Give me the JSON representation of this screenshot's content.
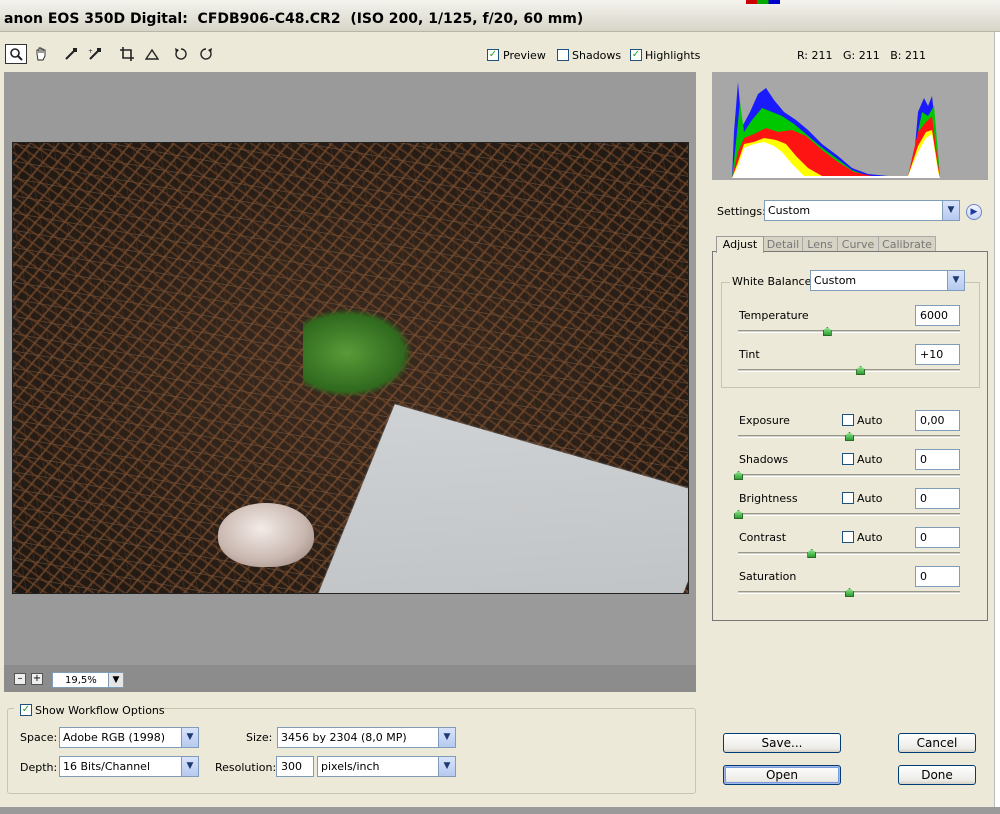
{
  "window": {
    "title": "anon EOS 350D Digital:  CFDB906-C48.CR2  (ISO 200, 1/125, f/20, 60 mm)"
  },
  "toolbar": {
    "tools": [
      "zoom-icon",
      "hand-icon",
      "white-balance-icon",
      "color-sampler-icon",
      "crop-icon",
      "straighten-icon",
      "rotate-left-icon",
      "rotate-right-icon"
    ],
    "preview_label": "Preview",
    "preview_checked": true,
    "shadows_label": "Shadows",
    "shadows_checked": false,
    "highlights_label": "Highlights",
    "highlights_checked": true,
    "rgb_readout": "R: 211   G: 211   B: 211"
  },
  "zoom": {
    "minus": "–",
    "plus": "+",
    "value": "19,5%"
  },
  "workflow": {
    "show_label": "Show Workflow Options",
    "show_checked": true,
    "space_label": "Space:",
    "space_value": "Adobe RGB (1998)",
    "depth_label": "Depth:",
    "depth_value": "16 Bits/Channel",
    "size_label": "Size:",
    "size_value": "3456 by 2304  (8,0 MP)",
    "resolution_label": "Resolution:",
    "resolution_value": "300",
    "resolution_unit": "pixels/inch"
  },
  "settings": {
    "label": "Settings:",
    "value": "Custom"
  },
  "tabs": [
    "Adjust",
    "Detail",
    "Lens",
    "Curve",
    "Calibrate"
  ],
  "adjust": {
    "white_balance_label": "White Balance:",
    "white_balance_value": "Custom",
    "temperature_label": "Temperature",
    "temperature_value": "6000",
    "temperature_level": 0.4,
    "tint_label": "Tint",
    "tint_value": "+10",
    "tint_level": 0.55,
    "exposure_label": "Exposure",
    "exposure_value": "0,00",
    "exposure_level": 0.5,
    "shadows_label": "Shadows",
    "shadows_value": "0",
    "shadows_level": 0.0,
    "brightness_label": "Brightness",
    "brightness_value": "0",
    "brightness_level": 0.0,
    "contrast_label": "Contrast",
    "contrast_value": "0",
    "contrast_level": 0.33,
    "saturation_label": "Saturation",
    "saturation_value": "0",
    "saturation_level": 0.5,
    "auto_label": "Auto"
  },
  "buttons": {
    "save": "Save...",
    "cancel": "Cancel",
    "open": "Open",
    "done": "Done"
  },
  "colors": {
    "accent": "#21a121",
    "preview_bg": "#9a9a9a",
    "panel_bg": "#ece9d8"
  }
}
